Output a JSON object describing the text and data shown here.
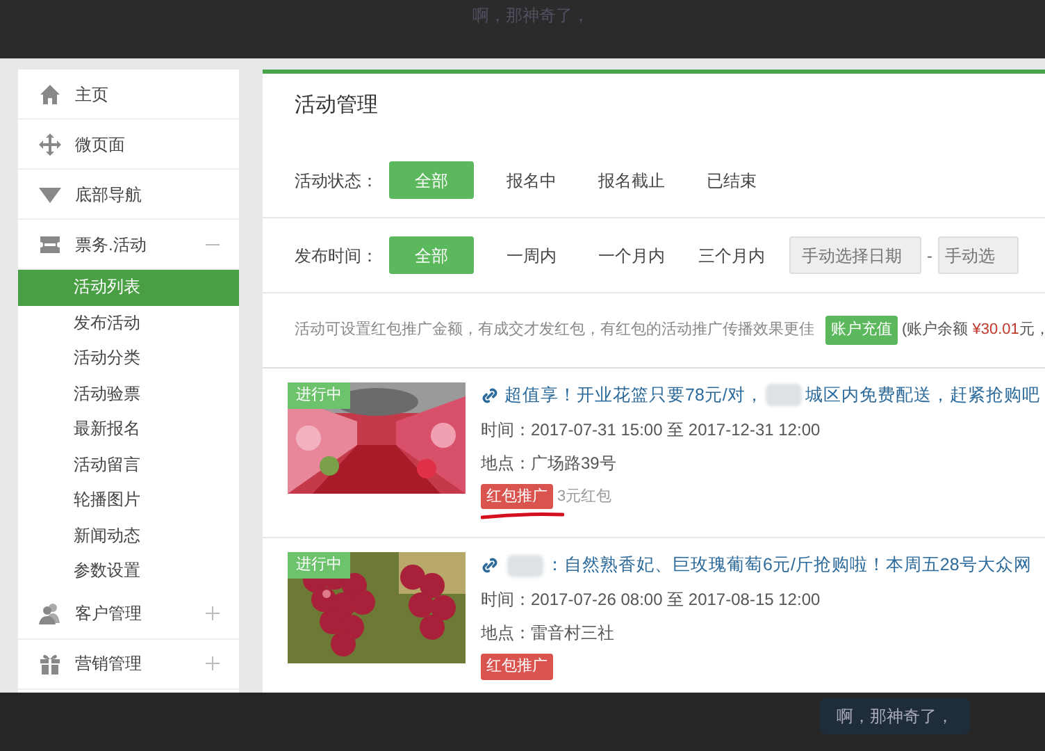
{
  "overlay_top": {
    "message": "啊，那神奇了，"
  },
  "sidebar": {
    "items": [
      {
        "label": "主页",
        "kind": "home"
      },
      {
        "label": "微页面",
        "kind": "move"
      },
      {
        "label": "底部导航",
        "kind": "triangle"
      },
      {
        "label": "票务.活动",
        "kind": "ticket",
        "expanded": true,
        "children": [
          {
            "label": "活动列表",
            "selected": true
          },
          {
            "label": "发布活动",
            "selected": false
          },
          {
            "label": "活动分类",
            "selected": false
          },
          {
            "label": "活动验票",
            "selected": false
          },
          {
            "label": "最新报名",
            "selected": false
          },
          {
            "label": "活动留言",
            "selected": false
          },
          {
            "label": "轮播图片",
            "selected": false
          },
          {
            "label": "新闻动态",
            "selected": false
          },
          {
            "label": "参数设置",
            "selected": false
          }
        ]
      },
      {
        "label": "客户管理",
        "kind": "users",
        "expanded": false
      },
      {
        "label": "营销管理",
        "kind": "gift",
        "expanded": false
      }
    ]
  },
  "panel": {
    "title": "活动管理",
    "filters": [
      {
        "label": "活动状态：",
        "options": [
          {
            "label": "全部",
            "selected": true
          },
          {
            "label": "报名中",
            "selected": false
          },
          {
            "label": "报名截止",
            "selected": false
          },
          {
            "label": "已结束",
            "selected": false
          }
        ]
      },
      {
        "label": "发布时间：",
        "options": [
          {
            "label": "全部",
            "selected": true
          },
          {
            "label": "一周内",
            "selected": false
          },
          {
            "label": "一个月内",
            "selected": false
          },
          {
            "label": "三个月内",
            "selected": false
          }
        ],
        "date_from": {
          "placeholder": "手动选择日期"
        },
        "separator": "-",
        "date_to": {
          "placeholder": "手动选"
        }
      }
    ],
    "notice": {
      "text": "活动可设置红包推广金额，有成交才发红包，有红包的活动推广传播效果更佳",
      "button": "账户充值",
      "balance_prefix": "(账户余额",
      "balance_amount": "¥30.01",
      "balance_suffix": "元，"
    },
    "activities": [
      {
        "status": "进行中",
        "kind": "picture",
        "title_before": "超值享！开业花篮只要78元/对，",
        "title_after": "城区内免费配送，赶紧抢购吧",
        "time": "时间：2017-07-31 15:00 至 2017-12-31 12:00",
        "place": "地点：广场路39号",
        "tag": "红包推广",
        "bonus": "3元红包",
        "underlined": true
      },
      {
        "status": "进行中",
        "kind": "picture",
        "title_after": "：自然熟香妃、巨玫瑰葡萄6元/斤抢购啦！本周五28号大众网",
        "time": "时间：2017-07-26 08:00 至 2017-08-15 12:00",
        "place": "地点：雷音村三社",
        "tag": "红包推广",
        "underlined": false
      }
    ]
  },
  "overlay_bottom": {
    "message": "啊，那神奇了，"
  }
}
